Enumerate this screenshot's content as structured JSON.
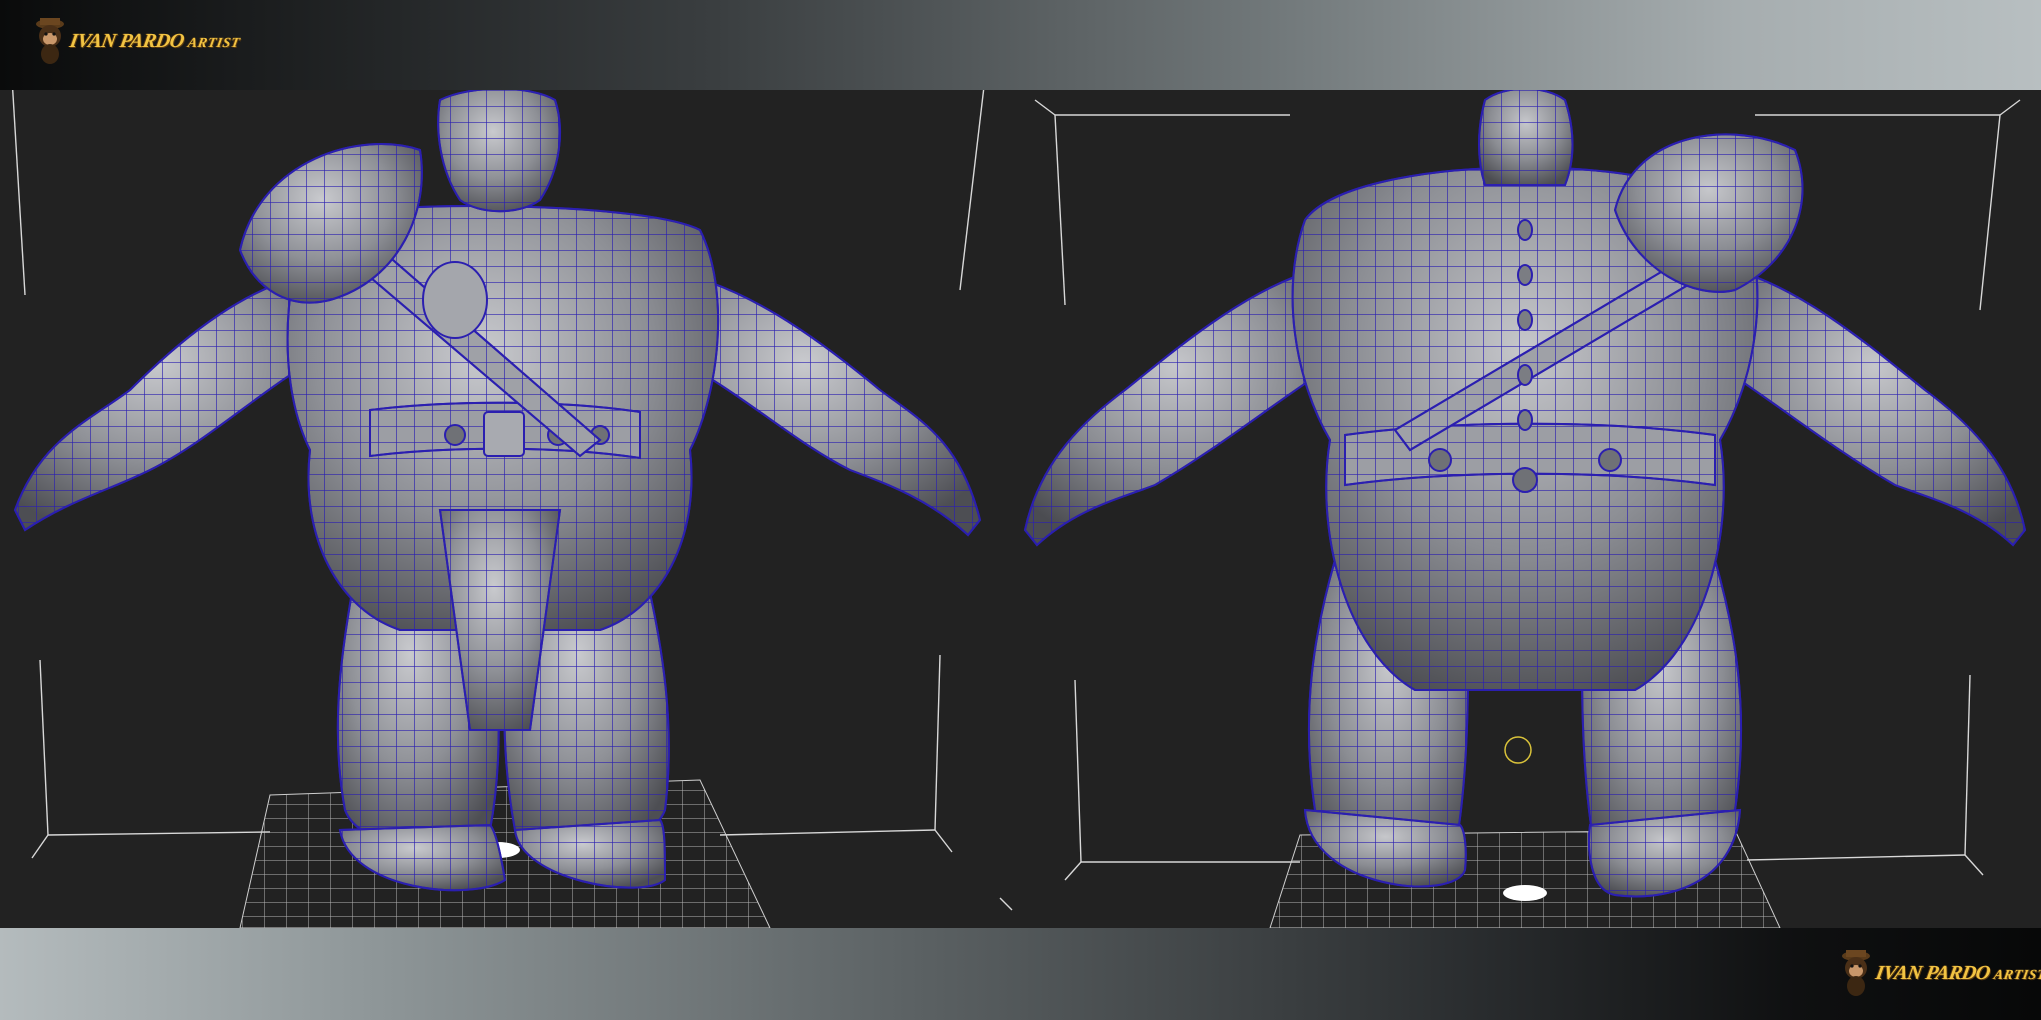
{
  "logo": {
    "name_a": "IVAN",
    "name_b": "PARDO",
    "name_c": "ARTIST",
    "mascot_icon": "monkey-head-icon",
    "color": "#f2c443"
  },
  "views": [
    {
      "id": "front",
      "subject": "3d-character-wireframe-front"
    },
    {
      "id": "back",
      "subject": "3d-character-wireframe-back"
    }
  ],
  "colors": {
    "background": "#222222",
    "wire": "#2b1fb0",
    "surface": "#8d8f95",
    "grid": "#cfcfcf",
    "box_lines": "#d8d8d8",
    "pivot": "#d9c23a"
  }
}
